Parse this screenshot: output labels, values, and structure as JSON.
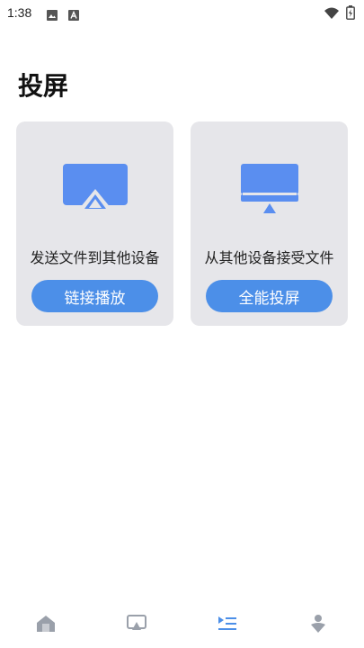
{
  "status": {
    "time": "1:38",
    "icons_left": [
      "image-icon",
      "text-box-icon"
    ],
    "icons_right": [
      "wifi-icon",
      "battery-charging-icon"
    ]
  },
  "page": {
    "title": "投屏"
  },
  "cards": [
    {
      "label": "发送文件到其他设备",
      "button": "链接播放",
      "icon": "airplay-icon"
    },
    {
      "label": "从其他设备接受文件",
      "button": "全能投屏",
      "icon": "monitor-cast-icon"
    }
  ],
  "colors": {
    "accent": "#4c8fe8",
    "icon_blue": "#5a8ef0",
    "card_bg": "#e6e6ea",
    "tab_inactive": "#9aa0aa",
    "tab_active": "#4c8fe8"
  },
  "tabs": [
    {
      "icon": "home-icon",
      "active": false
    },
    {
      "icon": "screencast-icon",
      "active": false
    },
    {
      "icon": "playlist-icon",
      "active": true
    },
    {
      "icon": "profile-icon",
      "active": false
    }
  ]
}
